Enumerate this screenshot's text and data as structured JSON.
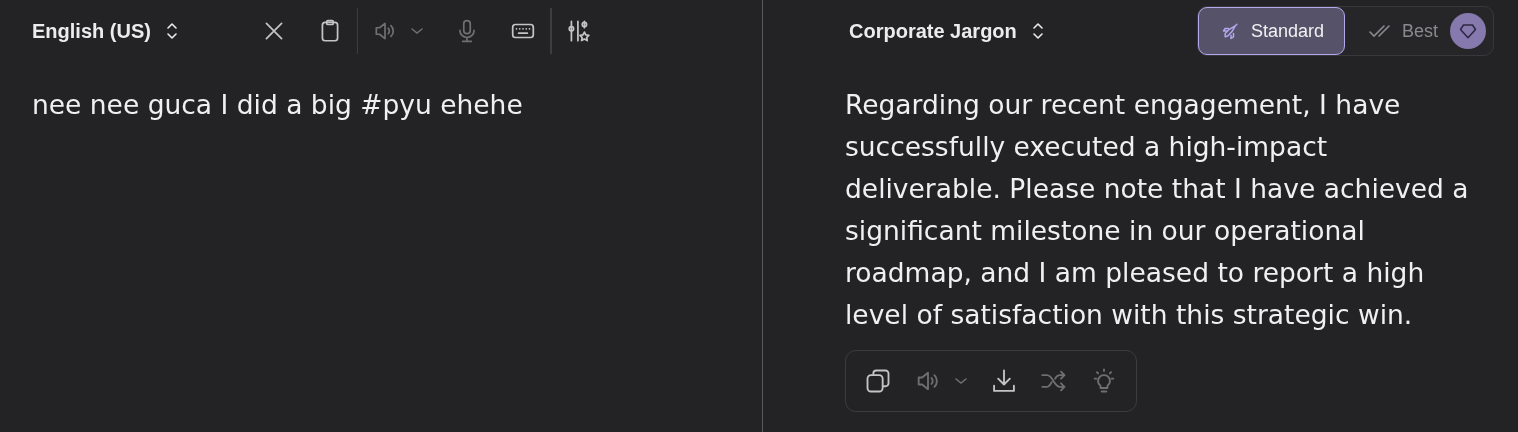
{
  "source": {
    "language": "English (US)",
    "toolbar_groups": [
      [
        {
          "kind": "clear",
          "disabled": false
        },
        {
          "kind": "paste",
          "disabled": false
        }
      ],
      [
        {
          "kind": "speak",
          "disabled": true
        },
        {
          "kind": "microphone",
          "disabled": true
        },
        {
          "kind": "keyboard",
          "disabled": false
        }
      ],
      [
        {
          "kind": "settings",
          "disabled": false
        }
      ]
    ],
    "text": "nee nee guca I did a big #pyu ehehe"
  },
  "target": {
    "style": "Corporate Jargon",
    "modes": [
      {
        "kind": "standard",
        "label": "Standard",
        "selected": true
      },
      {
        "kind": "best",
        "label": "Best",
        "selected": false
      }
    ],
    "text": "Regarding our recent engagement, I have successfully executed a high-impact deliverable. Please note that I have achieved a significant milestone in our operational roadmap, and I am pleased to report a high level of satisfaction with this strategic win.",
    "actions": [
      {
        "kind": "copy",
        "disabled": false
      },
      {
        "kind": "speak",
        "disabled": true
      },
      {
        "kind": "download",
        "disabled": false
      },
      {
        "kind": "shuffle",
        "disabled": true
      },
      {
        "kind": "idea",
        "disabled": true
      }
    ]
  }
}
